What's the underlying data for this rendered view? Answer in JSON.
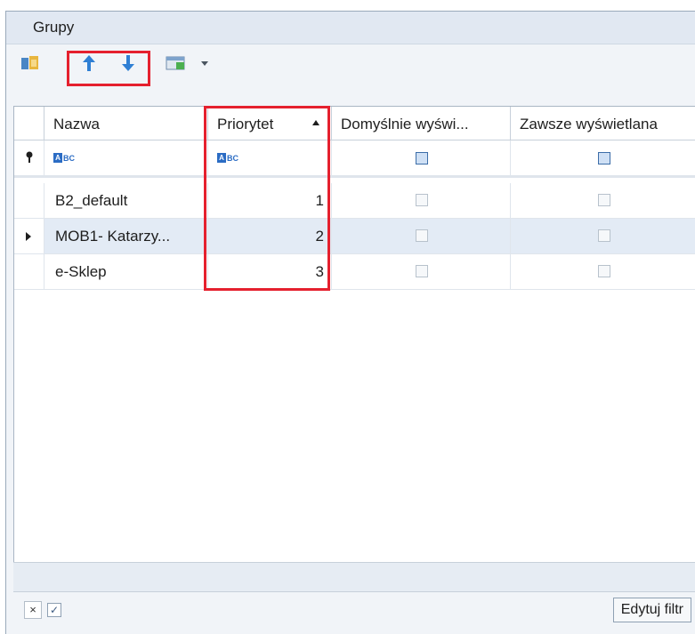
{
  "header": {
    "title": "Grupy"
  },
  "toolbar": {
    "buttons": [
      {
        "name": "groups-icon"
      },
      {
        "name": "arrow-up-icon"
      },
      {
        "name": "arrow-down-icon"
      },
      {
        "name": "filter-view-icon"
      },
      {
        "name": "dropdown-arrow-icon"
      }
    ]
  },
  "grid": {
    "columns": [
      "Nazwa",
      "Priorytet",
      "Domyślnie wyświ...",
      "Zawsze wyświetlana"
    ],
    "sort_column": "Priorytet",
    "sort_direction": "ascending",
    "rows": [
      {
        "name": "B2_default",
        "priority": "1",
        "default": false,
        "always": false
      },
      {
        "name": "MOB1- Katarzy...",
        "priority": "2",
        "default": false,
        "always": false,
        "current": true
      },
      {
        "name": "e-Sklep",
        "priority": "3",
        "default": false,
        "always": false
      }
    ]
  },
  "filter": {
    "clear_label": "×",
    "enabled": true,
    "edit_label": "Edytuj filtr"
  },
  "highlight_color": "#e5202e"
}
